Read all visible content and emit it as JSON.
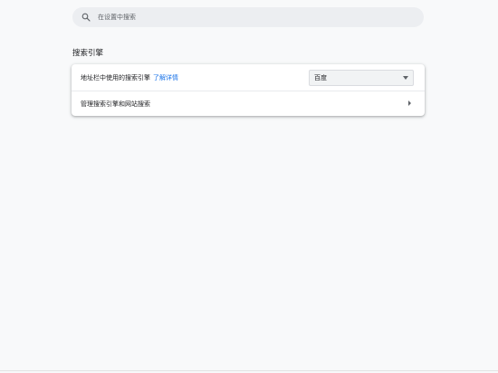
{
  "search": {
    "placeholder": "在设置中搜索"
  },
  "section": {
    "title": "搜索引擎"
  },
  "card": {
    "engine_row": {
      "label": "地址栏中使用的搜索引擎",
      "link": "了解详情",
      "selected": "百度"
    },
    "manage_row": {
      "label": "管理搜索引擎和网站搜索"
    }
  },
  "colors": {
    "link": "#1a73e8",
    "background": "#f8f9fa",
    "card": "#ffffff"
  },
  "icons": [
    "search-icon",
    "dropdown-caret-icon",
    "chevron-right-icon"
  ]
}
